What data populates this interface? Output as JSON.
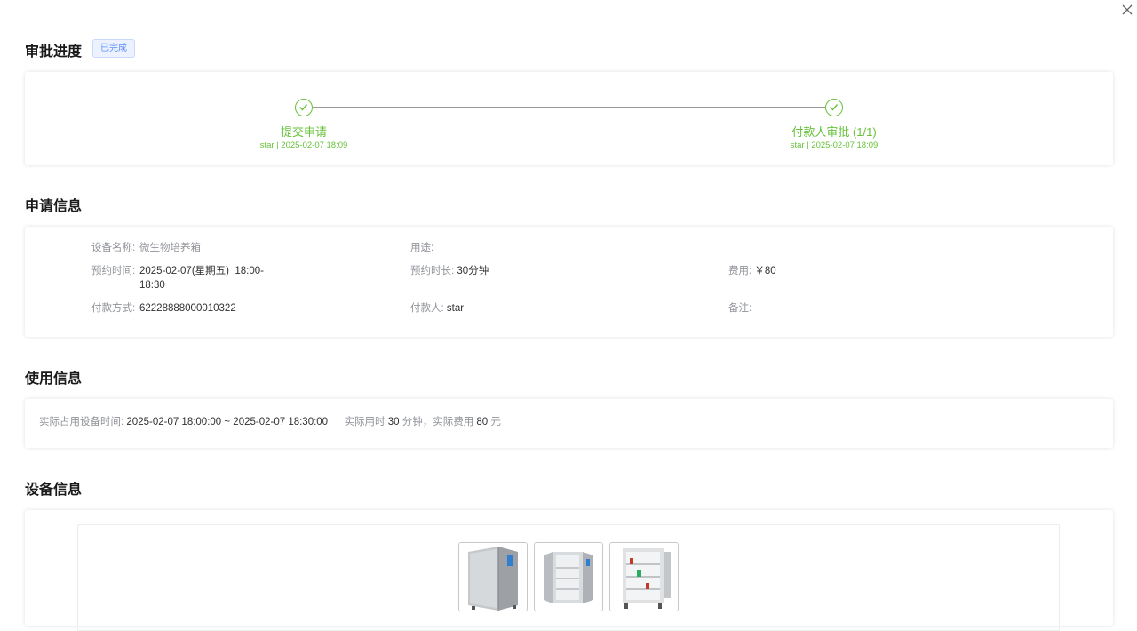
{
  "approval": {
    "title": "审批进度",
    "status_badge": "已完成",
    "steps": [
      {
        "title": "提交申请",
        "desc": "star | 2025-02-07 18:09"
      },
      {
        "title": "付款人审批 (1/1)",
        "desc": "star | 2025-02-07 18:09"
      }
    ]
  },
  "application": {
    "title": "申请信息",
    "device_name_label": "设备名称:",
    "device_name": "微生物培养箱",
    "purpose_label": "用途:",
    "purpose": "",
    "booking_time_label": "预约时间:",
    "booking_time_line1": "2025-02-07(星期五)  18:00-",
    "booking_time_line2": "18:30",
    "duration_label": "预约时长:",
    "duration": "30分钟",
    "fee_label": "费用:",
    "fee": "￥80",
    "payment_method_label": "付款方式:",
    "payment_method": "62228888000010322",
    "payer_label": "付款人:",
    "payer": "star",
    "remarks_label": "备注:",
    "remarks": ""
  },
  "usage": {
    "title": "使用信息",
    "actual_time_label": "实际占用设备时间:",
    "actual_time": "2025-02-07 18:00:00 ~ 2025-02-07 18:30:00",
    "actual_use_prefix": "实际用时",
    "actual_minutes": "30",
    "minutes_unit": "分钟，实际费用",
    "actual_fee": "80",
    "fee_unit": "元"
  },
  "device": {
    "title": "设备信息",
    "images": [
      "incubator-front",
      "incubator-open-doors",
      "incubator-open-interior"
    ]
  },
  "colors": {
    "success": "#67c23a",
    "badge_text": "#5b8ff9",
    "badge_bg": "#ecf2ff"
  },
  "icons": [
    "close-icon",
    "check-icon"
  ]
}
